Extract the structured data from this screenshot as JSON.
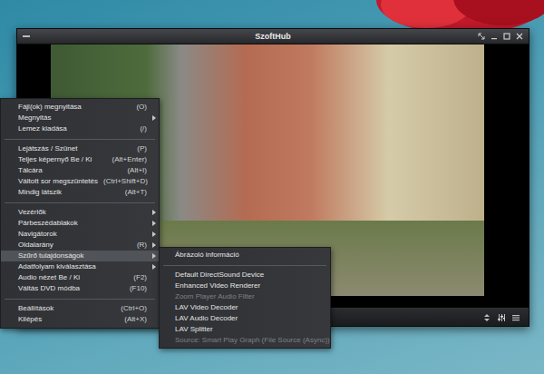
{
  "window": {
    "title": "SzoftHub"
  },
  "context_menu": {
    "items": [
      {
        "kind": "item",
        "label": "Fájl(ok) megnyitása",
        "shortcut": "(O)",
        "has_submenu": false,
        "selected": false
      },
      {
        "kind": "item",
        "label": "Megnyitás",
        "shortcut": "",
        "has_submenu": true,
        "selected": false
      },
      {
        "kind": "item",
        "label": "Lemez kiadása",
        "shortcut": "(/)",
        "has_submenu": false,
        "selected": false
      },
      {
        "kind": "separator"
      },
      {
        "kind": "item",
        "label": "Lejátszás / Szünet",
        "shortcut": "(P)",
        "has_submenu": false,
        "selected": false
      },
      {
        "kind": "item",
        "label": "Teljes képernyő Be / Ki",
        "shortcut": "(Alt+Enter)",
        "has_submenu": false,
        "selected": false
      },
      {
        "kind": "item",
        "label": "Tálcára",
        "shortcut": "(Alt+I)",
        "has_submenu": false,
        "selected": false
      },
      {
        "kind": "item",
        "label": "Váltott sor megszüntetés",
        "shortcut": "(Ctrl+Shift+D)",
        "has_submenu": false,
        "selected": false
      },
      {
        "kind": "item",
        "label": "Mindig látszik",
        "shortcut": "(Alt+T)",
        "has_submenu": false,
        "selected": false
      },
      {
        "kind": "separator"
      },
      {
        "kind": "item",
        "label": "Vezérlők",
        "shortcut": "",
        "has_submenu": true,
        "selected": false
      },
      {
        "kind": "item",
        "label": "Párbeszédablakok",
        "shortcut": "",
        "has_submenu": true,
        "selected": false
      },
      {
        "kind": "item",
        "label": "Navigátorok",
        "shortcut": "",
        "has_submenu": true,
        "selected": false
      },
      {
        "kind": "item",
        "label": "Oldalarány",
        "shortcut": "(R)",
        "has_submenu": true,
        "selected": false
      },
      {
        "kind": "item",
        "label": "Szűrő tulajdonságok",
        "shortcut": "",
        "has_submenu": true,
        "selected": true
      },
      {
        "kind": "item",
        "label": "Adatfolyam kiválasztása",
        "shortcut": "",
        "has_submenu": true,
        "selected": false
      },
      {
        "kind": "item",
        "label": "Audio nézet Be / Ki",
        "shortcut": "(F2)",
        "has_submenu": false,
        "selected": false
      },
      {
        "kind": "item",
        "label": "Váltás DVD módba",
        "shortcut": "(F10)",
        "has_submenu": false,
        "selected": false
      },
      {
        "kind": "separator"
      },
      {
        "kind": "item",
        "label": "Beállítások",
        "shortcut": "(Ctrl+O)",
        "has_submenu": false,
        "selected": false
      },
      {
        "kind": "item",
        "label": "Kilépés",
        "shortcut": "(Alt+X)",
        "has_submenu": false,
        "selected": false
      }
    ]
  },
  "submenu": {
    "items": [
      {
        "kind": "item",
        "label": "Ábrázoló információ",
        "disabled": false
      },
      {
        "kind": "separator"
      },
      {
        "kind": "item",
        "label": "Default DirectSound Device",
        "disabled": false
      },
      {
        "kind": "item",
        "label": "Enhanced Video Renderer",
        "disabled": false
      },
      {
        "kind": "item",
        "label": "Zoom Player Audio Filter",
        "disabled": true
      },
      {
        "kind": "item",
        "label": "LAV Video Decoder",
        "disabled": false
      },
      {
        "kind": "item",
        "label": "LAV Audio Decoder",
        "disabled": false
      },
      {
        "kind": "item",
        "label": "LAV Splitter",
        "disabled": false
      },
      {
        "kind": "item",
        "label": "Source: Smart Play Graph (File Source (Async))",
        "disabled": true
      }
    ]
  }
}
